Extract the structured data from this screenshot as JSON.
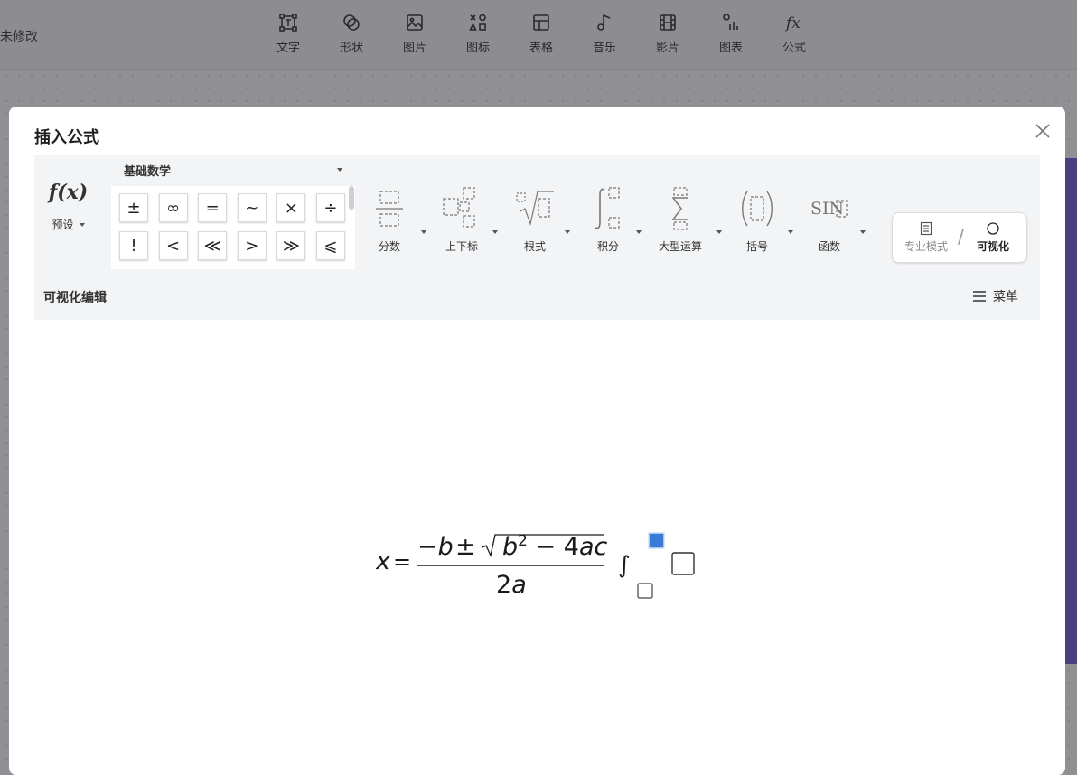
{
  "app": {
    "status_text": "未修改",
    "toolbar": [
      {
        "label": "文字",
        "icon": "text-box-icon"
      },
      {
        "label": "形状",
        "icon": "shapes-icon"
      },
      {
        "label": "图片",
        "icon": "image-icon"
      },
      {
        "label": "图标",
        "icon": "icon-library-icon"
      },
      {
        "label": "表格",
        "icon": "table-icon"
      },
      {
        "label": "音乐",
        "icon": "music-note-icon"
      },
      {
        "label": "影片",
        "icon": "film-icon"
      },
      {
        "label": "图表",
        "icon": "chart-icon"
      },
      {
        "label": "公式",
        "icon": "fx-icon"
      }
    ]
  },
  "dialog": {
    "title": "插入公式",
    "fx_logo": "f(x)",
    "preset_label": "预设",
    "category": "基础数学",
    "symbols": [
      "±",
      "∞",
      "=",
      "~",
      "×",
      "÷",
      "!",
      "<",
      "≪",
      ">",
      "≫",
      "⩽"
    ],
    "structures": [
      {
        "label": "分数",
        "icon": "fraction-icon"
      },
      {
        "label": "上下标",
        "icon": "script-icon"
      },
      {
        "label": "根式",
        "icon": "radical-icon"
      },
      {
        "label": "积分",
        "icon": "integral-icon"
      },
      {
        "label": "大型运算",
        "icon": "large-operator-icon"
      },
      {
        "label": "括号",
        "icon": "bracket-icon"
      },
      {
        "label": "函数",
        "icon": "function-icon"
      }
    ],
    "modes": {
      "professional": "专业模式",
      "visual": "可视化",
      "active": "可视化"
    },
    "edit_bar_label": "可视化编辑",
    "menu_label": "菜单",
    "formula": {
      "lhs": "x",
      "equals": "=",
      "numerator": "−b ± √ b² − 4ac",
      "denominator": "2a",
      "trailing": "∫ with empty placeholders"
    },
    "colors": {
      "accent": "#3a7bd5",
      "panel": "#f3f4f6"
    }
  }
}
